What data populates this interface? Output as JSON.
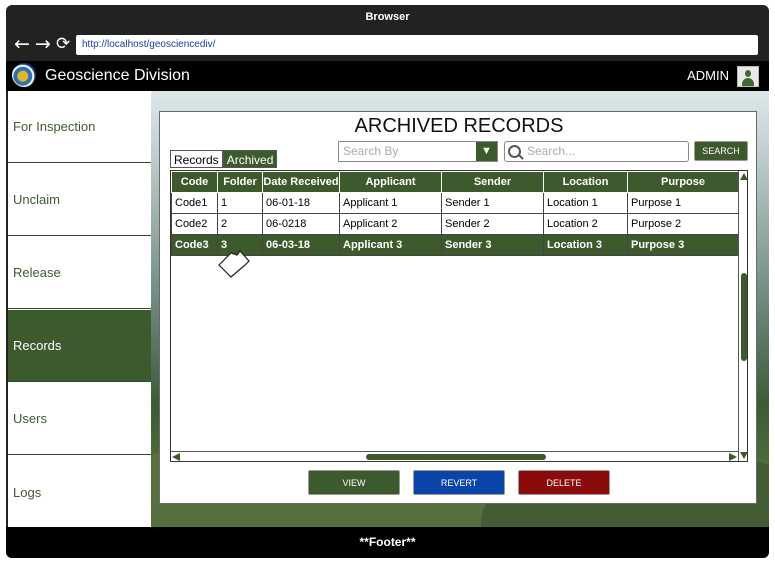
{
  "browser": {
    "title": "Browser",
    "url": "http://localhost/geosciencediv/",
    "icons": [
      "back-arrow-icon",
      "forward-arrow-icon",
      "reload-icon"
    ]
  },
  "app": {
    "title": "Geoscience Division",
    "user": "ADMIN"
  },
  "sidebar": {
    "items": [
      {
        "label": "For Inspection",
        "active": false
      },
      {
        "label": "Unclaim",
        "active": false
      },
      {
        "label": "Release",
        "active": false
      },
      {
        "label": "Records",
        "active": true
      },
      {
        "label": "Users",
        "active": false
      },
      {
        "label": "Logs",
        "active": false
      }
    ]
  },
  "main": {
    "title": "ARCHIVED RECORDS",
    "tabs": [
      {
        "label": "Records",
        "selected": false
      },
      {
        "label": "Archived",
        "selected": true
      }
    ],
    "search_by": {
      "placeholder": "Search By"
    },
    "search": {
      "placeholder": "Search..."
    },
    "search_button": "SEARCH",
    "table": {
      "columns": [
        "Code",
        "Folder",
        "Date Received",
        "Applicant",
        "Sender",
        "Location",
        "Purpose"
      ],
      "rows": [
        [
          "Code1",
          "1",
          "06-01-18",
          "Applicant 1",
          "Sender 1",
          "Location 1",
          "Purpose 1"
        ],
        [
          "Code2",
          "2",
          "06-0218",
          "Applicant 2",
          "Sender 2",
          "Location 2",
          "Purpose 2"
        ],
        [
          "Code3",
          "3",
          "06-03-18",
          "Applicant 3",
          "Sender 3",
          "Location 3",
          "Purpose 3"
        ]
      ],
      "selected_row": 2
    },
    "actions": {
      "view": "VIEW",
      "revert": "REVERT",
      "delete": "DELETE"
    }
  },
  "footer": "**Footer**",
  "colors": {
    "primary_green": "#3d5a2c",
    "revert_blue": "#0a44a8",
    "delete_red": "#8a0b0b"
  }
}
